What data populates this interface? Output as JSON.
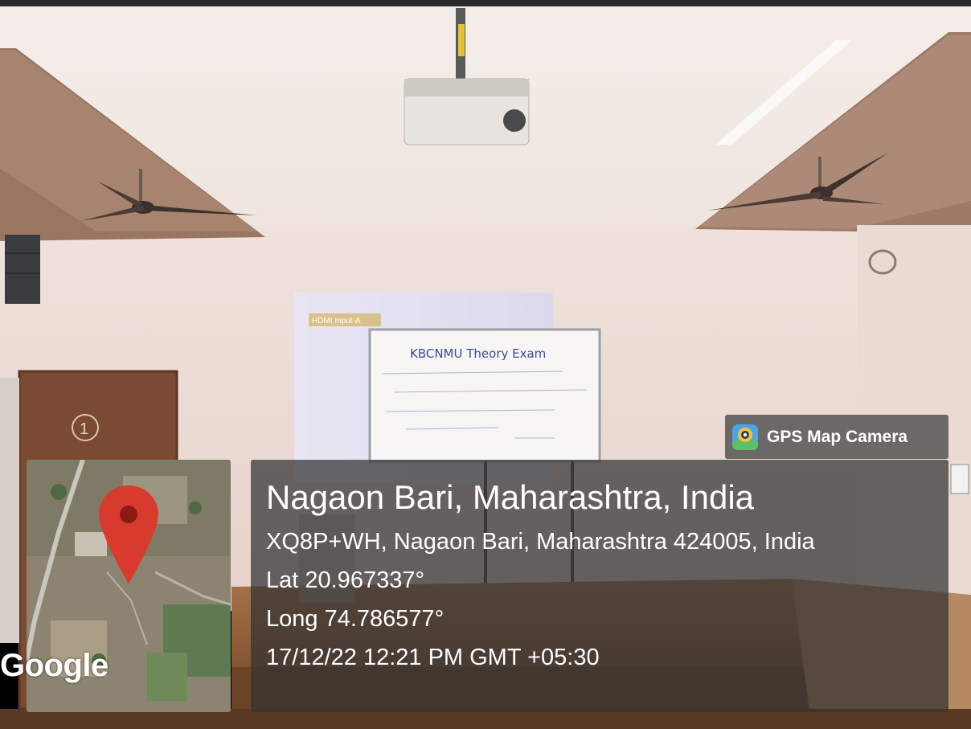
{
  "watermark": {
    "app_name": "GPS Map Camera",
    "app_icon": "map-pin-camera-icon"
  },
  "map": {
    "provider_label": "Google",
    "marker_icon": "location-pin-icon",
    "marker_color": "#d93a2e"
  },
  "location": {
    "title": "Nagaon Bari, Maharashtra, India",
    "address": "XQ8P+WH, Nagaon Bari, Maharashtra 424005, India",
    "latitude": "Lat 20.967337°",
    "longitude": "Long 74.786577°",
    "datetime": "17/12/22 12:21 PM GMT +05:30"
  },
  "scene": {
    "projector_label": "HDMI Input-A",
    "door_number": "1",
    "whiteboard_text": "KBCNMU Theory Exam"
  }
}
